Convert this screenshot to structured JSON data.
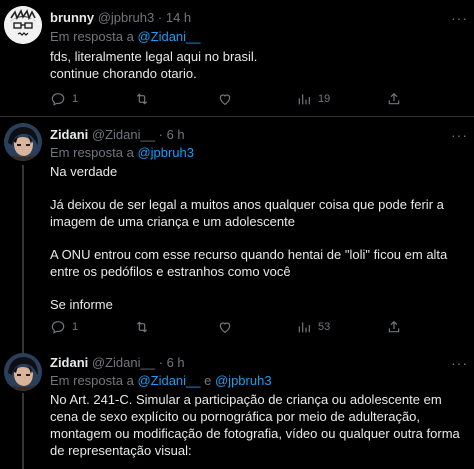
{
  "tweets": [
    {
      "name": "brunny",
      "handle": "@jpbruh3",
      "separator": "·",
      "time": "14 h",
      "reply_prefix": "Em resposta a ",
      "reply_to": "@Zidani__",
      "lines": [
        "fds, literalmente legal aqui no brasil.",
        "continue chorando otario."
      ],
      "replies": "1",
      "retweets": "",
      "likes": "",
      "views": "19"
    },
    {
      "name": "Zidani",
      "handle": "@Zidani__",
      "separator": "·",
      "time": "6 h",
      "reply_prefix": "Em resposta a ",
      "reply_to": "@jpbruh3",
      "lines": [
        "Na verdade",
        "Já deixou de ser legal a muitos anos qualquer coisa que pode ferir a imagem de uma criança e um adolescente",
        "A ONU entrou com esse recurso quando hentai de \"loli\" ficou em alta entre os pedófilos e estranhos como você",
        "Se informe"
      ],
      "replies": "1",
      "retweets": "",
      "likes": "",
      "views": "53"
    },
    {
      "name": "Zidani",
      "handle": "@Zidani__",
      "separator": "·",
      "time": "6 h",
      "reply_prefix": "Em resposta a ",
      "reply_to": "@Zidani__",
      "reply_join": " e ",
      "reply_to_2": "@jpbruh3",
      "lines": [
        "No Art. 241-C. Simular a participação de criança ou adolescente em cena de sexo explícito ou pornográfica por meio de adulteração, montagem ou modificação de fotografia, vídeo ou qualquer outra forma de representação visual:"
      ]
    }
  ],
  "more_label": "···",
  "colors": {
    "background": "#000000",
    "text": "#e7e9ea",
    "muted": "#71767b",
    "accent": "#1d9bf0",
    "divider": "#2f3336"
  },
  "icons": [
    "reply-icon",
    "retweet-icon",
    "like-icon",
    "views-icon",
    "share-icon",
    "more-icon"
  ]
}
